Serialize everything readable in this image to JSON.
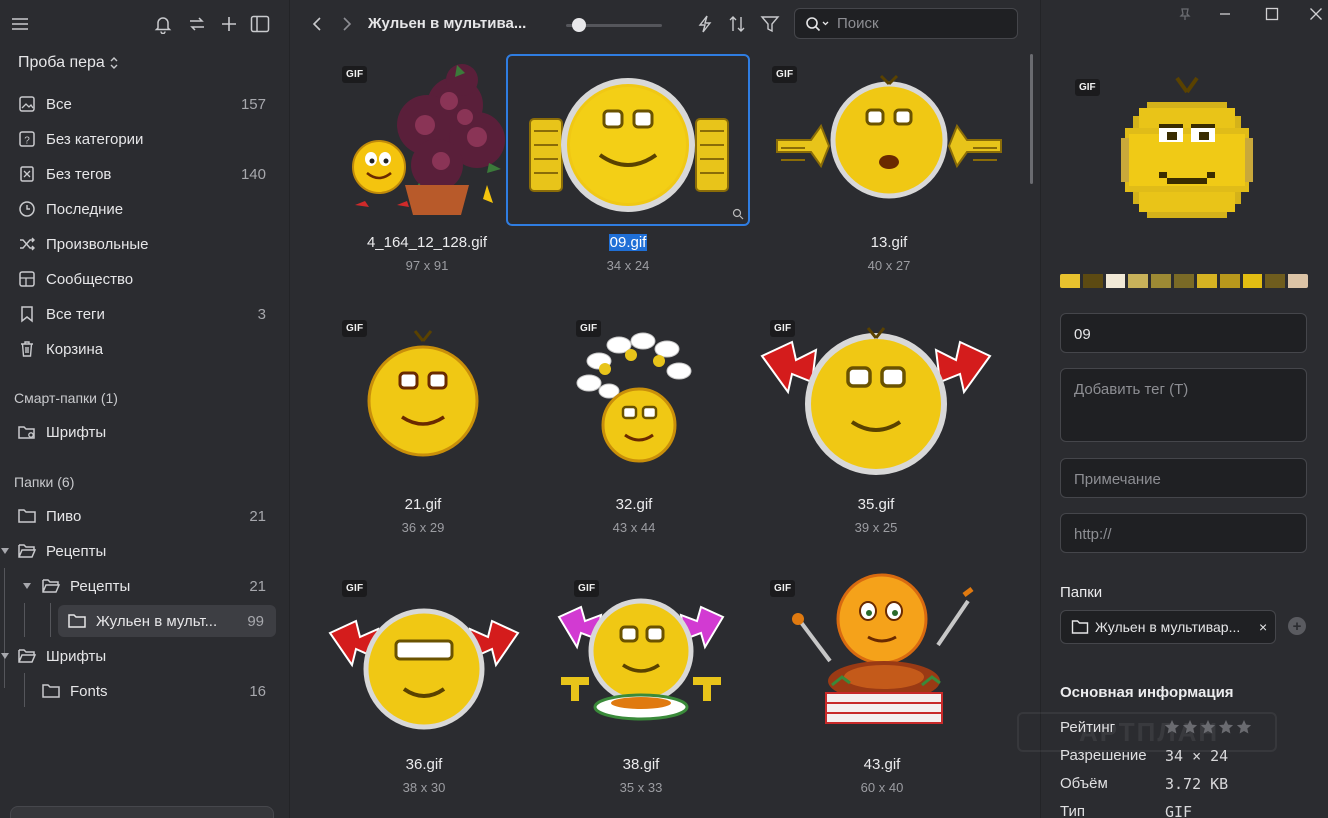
{
  "sidebar": {
    "library_name": "Проба пера",
    "nav": [
      {
        "label": "Все",
        "count": "157",
        "icon": "images-icon"
      },
      {
        "label": "Без категории",
        "count": "",
        "icon": "uncategorized-icon"
      },
      {
        "label": "Без тегов",
        "count": "140",
        "icon": "untagged-icon"
      },
      {
        "label": "Последние",
        "count": "",
        "icon": "clock-icon"
      },
      {
        "label": "Произвольные",
        "count": "",
        "icon": "shuffle-icon"
      },
      {
        "label": "Сообщество",
        "count": "",
        "icon": "community-icon"
      },
      {
        "label": "Все теги",
        "count": "3",
        "icon": "bookmark-icon"
      },
      {
        "label": "Корзина",
        "count": "",
        "icon": "trash-icon"
      }
    ],
    "smart_folders_title": "Смарт-папки (1)",
    "smart_folders": [
      {
        "label": "Шрифты",
        "count": ""
      }
    ],
    "folders_title": "Папки (6)",
    "folders": [
      {
        "label": "Пиво",
        "count": "21"
      },
      {
        "label": "Рецепты",
        "count": ""
      },
      {
        "label": "Рецепты",
        "count": "21"
      },
      {
        "label": "Жульен в мульт...",
        "count": "99"
      },
      {
        "label": "Шрифты",
        "count": ""
      },
      {
        "label": "Fonts",
        "count": "16"
      }
    ]
  },
  "toolbar": {
    "breadcrumb": "Жульен в мультива...",
    "search_placeholder": "Поиск"
  },
  "grid": {
    "items": [
      {
        "name": "4_164_12_128.gif",
        "dims": "97 x 91",
        "badge": "GIF"
      },
      {
        "name": "09.gif",
        "dims": "34 x 24",
        "badge": ""
      },
      {
        "name": "13.gif",
        "dims": "40 x 27",
        "badge": "GIF"
      },
      {
        "name": "21.gif",
        "dims": "36 x 29",
        "badge": "GIF"
      },
      {
        "name": "32.gif",
        "dims": "43 x 44",
        "badge": "GIF"
      },
      {
        "name": "35.gif",
        "dims": "39 x 25",
        "badge": "GIF"
      },
      {
        "name": "36.gif",
        "dims": "38 x 30",
        "badge": "GIF"
      },
      {
        "name": "38.gif",
        "dims": "35 x 33",
        "badge": "GIF"
      },
      {
        "name": "43.gif",
        "dims": "60 x 40",
        "badge": "GIF"
      }
    ]
  },
  "inspector": {
    "badge": "GIF",
    "palette": [
      "#e8c22e",
      "#5c4a12",
      "#f1e9d6",
      "#c8b25a",
      "#9d8a34",
      "#7a6a26",
      "#d6b322",
      "#b8981c",
      "#e2bd12",
      "#6f5d1e",
      "#dcc4a6"
    ],
    "name_value": "09",
    "tag_placeholder": "Добавить тег (T)",
    "note_placeholder": "Примечание",
    "url_placeholder": "http://",
    "folders_title": "Папки",
    "folder_chip": "Жульен в мультивар...",
    "folder_chip_close": "×",
    "info_title": "Основная информация",
    "rating_label": "Рейтинг",
    "resolution_label": "Разрешение",
    "resolution_value": "34 × 24",
    "size_label": "Объём",
    "size_value": "3.72 KB",
    "type_label": "Тип",
    "type_value": "GIF",
    "watermark": "АРТПЛАН"
  }
}
